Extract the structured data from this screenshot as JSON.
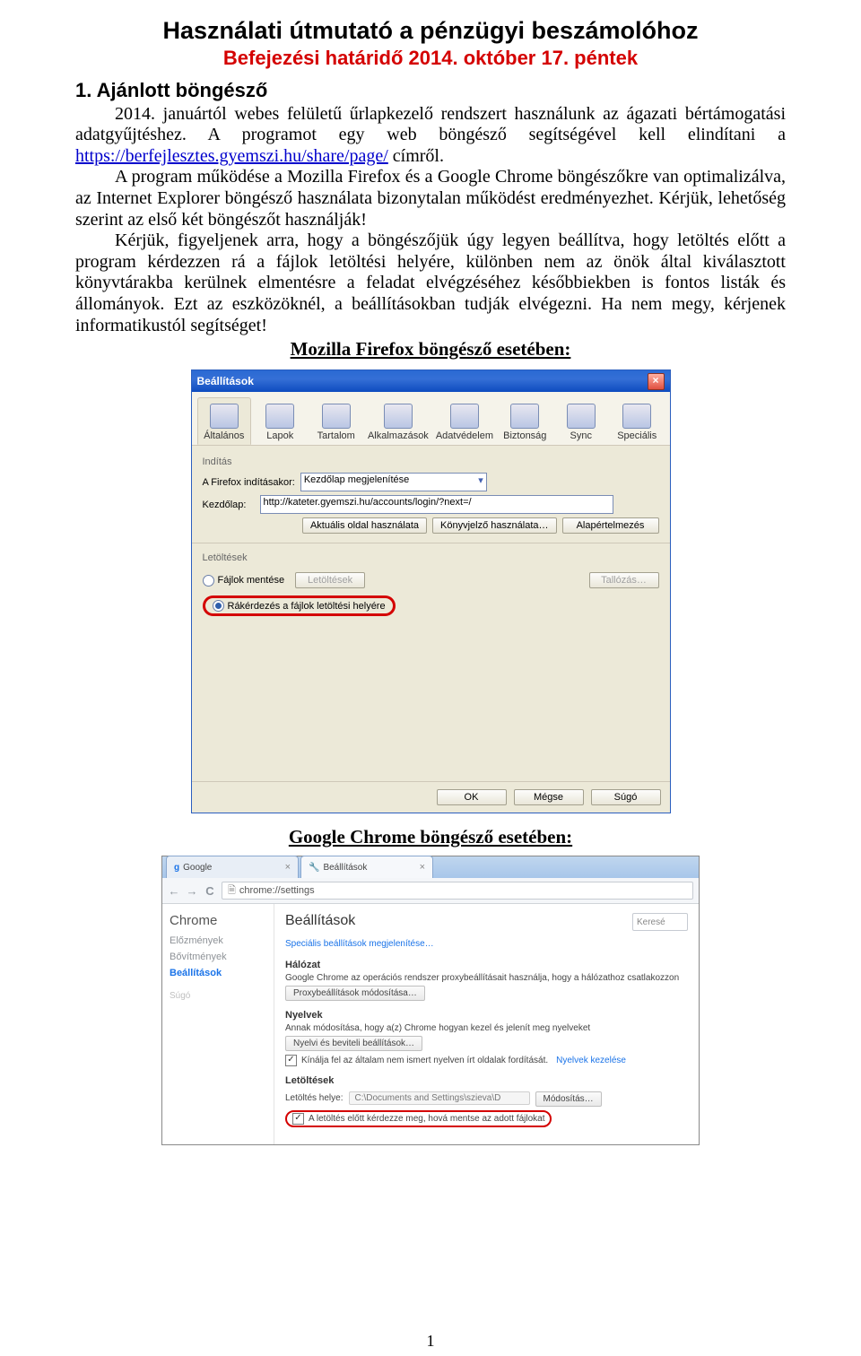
{
  "doc": {
    "title": "Használati útmutató a pénzügyi beszámolóhoz",
    "subtitle": "Befejezési határidő 2014. október 17. péntek",
    "h1": "1. Ajánlott böngésző",
    "para1a": "2014. januártól webes felületű űrlapkezelő rendszert használunk az ágazati bértámogatási adatgyűjtéshez. A programot egy web böngésző segítségével kell elindítani a ",
    "link_text": "https://berfejlesztes.gyemszi.hu/share/page/",
    "para1b": " címről.",
    "para2": "A program működése a Mozilla Firefox és a Google Chrome böngészőkre van optimalizálva, az Internet Explorer böngésző használata bizonytalan működést eredményezhet. Kérjük, lehetőség szerint az első két böngészőt használják!",
    "para3": "Kérjük, figyeljenek arra, hogy a böngészőjük úgy legyen beállítva, hogy letöltés előtt a program kérdezzen rá a fájlok letöltési helyére, különben nem az önök által kiválasztott könyvtárakba kerülnek elmentésre a feladat elvégzéséhez későbbiekben is fontos listák és állományok. Ezt az eszközöknél, a beállításokban tudják elvégezni. Ha nem megy, kérjenek informatikustól segítséget!",
    "firefox_heading": "Mozilla Firefox böngésző esetében:",
    "chrome_heading": "Google Chrome böngésző esetében:",
    "page_number": "1"
  },
  "firefox": {
    "title": "Beállítások",
    "tabs": [
      "Általános",
      "Lapok",
      "Tartalom",
      "Alkalmazások",
      "Adatvédelem",
      "Biztonság",
      "Sync",
      "Speciális"
    ],
    "active_tab": 0,
    "group_inditas": "Indítás",
    "label_inditaskor": "A Firefox indításakor:",
    "select_value": "Kezdőlap megjelenítése",
    "label_kezdolap": "Kezdőlap:",
    "kezdolap_value": "http://kateter.gyemszi.hu/accounts/login/?next=/",
    "btn_aktualis": "Aktuális oldal használata",
    "btn_konyvjelzo": "Könyvjelző használata…",
    "btn_alap": "Alapértelmezés",
    "group_letoltesek": "Letöltések",
    "radio_fajlok": "Fájlok mentése",
    "btn_letoltesek": "Letöltések",
    "btn_tallozas": "Tallózás…",
    "radio_rakerdezes": "Rákérdezés a fájlok letöltési helyére",
    "btn_ok": "OK",
    "btn_megse": "Mégse",
    "btn_sugo": "Súgó"
  },
  "chrome": {
    "tab1": "Google",
    "tab2": "Beállítások",
    "omnibox_prefix": "C",
    "omnibox_url": "chrome://settings",
    "sidebar_title": "Chrome",
    "sidebar_items": [
      "Előzmények",
      "Bővítmények",
      "Beállítások"
    ],
    "sidebar_sugo": "Súgó",
    "main_title": "Beállítások",
    "search_placeholder": "Keresé",
    "spec_link": "Speciális beállítások megjelenítése…",
    "halozat_title": "Hálózat",
    "halozat_text": "Google Chrome az operációs rendszer proxybeállításait használja, hogy a hálózathoz csatlakozzon",
    "btn_proxy": "Proxybeállítások módosítása…",
    "nyelvek_title": "Nyelvek",
    "nyelvek_text": "Annak módosítása, hogy a(z) Chrome hogyan kezel és jelenít meg nyelveket",
    "btn_nyelv": "Nyelvi és beviteli beállítások…",
    "check_forditas": "Kínálja fel az általam nem ismert nyelven írt oldalak fordítását.",
    "nyelvek_kezelese": "Nyelvek kezelése",
    "letoltesek_title": "Letöltések",
    "label_letoltesi_helye": "Letöltés helye:",
    "letoltesi_path": "C:\\Documents and Settings\\szieva\\D",
    "btn_modositas": "Módosítás…",
    "check_kerdezze": "A letöltés előtt kérdezze meg, hová mentse az adott fájlokat"
  }
}
